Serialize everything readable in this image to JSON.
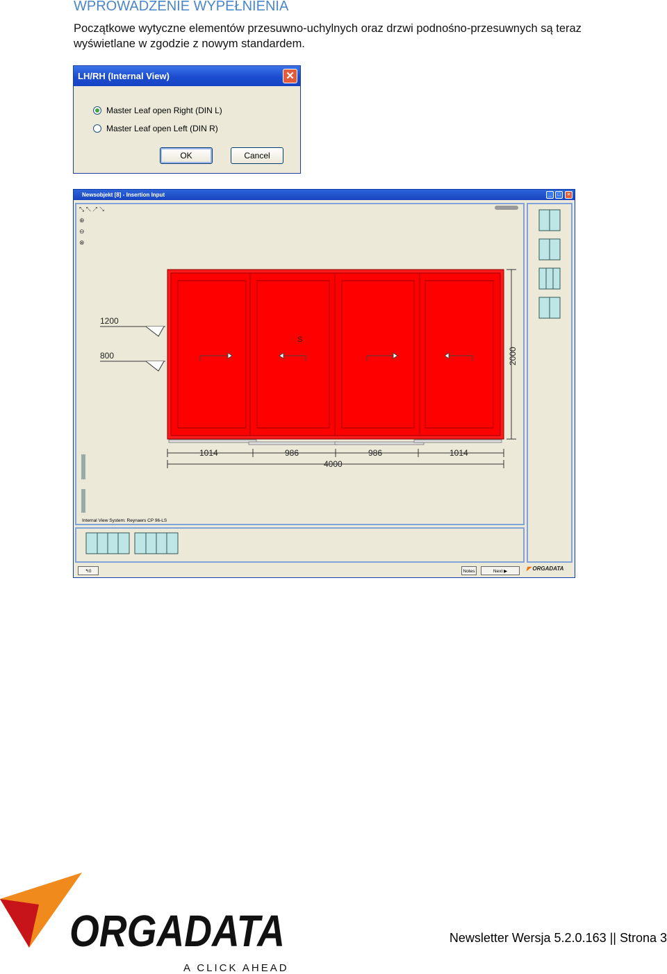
{
  "section": {
    "title": "WPROWADZENIE WYPEŁNIENIA"
  },
  "intro": {
    "line1": "Początkowe wytyczne elementów przesuwno-uchylnych oraz drzwi podnośno-przesuwnych są teraz",
    "line2": "wyświetlane w zgodzie z nowym standardem."
  },
  "dialog": {
    "title": "LH/RH (Internal View)",
    "close": "✕",
    "options": [
      {
        "label": "Master Leaf open Right (DIN L)",
        "selected": true
      },
      {
        "label": "Master Leaf open Left (DIN R)",
        "selected": false
      }
    ],
    "ok": "OK",
    "cancel": "Cancel"
  },
  "app": {
    "title": "Newsobjekt [8] - Insertion Input",
    "status": "Internal View   System: Reynaers CP 96-LS",
    "notes_button": "Notes",
    "next_button": "Next",
    "logo": "ORGADATA",
    "leaf_color": "#ff0000",
    "drawing": {
      "heights": [
        "1200",
        "800"
      ],
      "label_s": "S",
      "height": "2000",
      "widths": [
        "1014",
        "986",
        "986",
        "1014"
      ],
      "total": "4000"
    }
  },
  "footer": {
    "logo_name": "ORGADATA",
    "tagline": "A CLICK AHEAD",
    "text": "Newsletter Wersja 5.2.0.163 || Strona 3"
  }
}
